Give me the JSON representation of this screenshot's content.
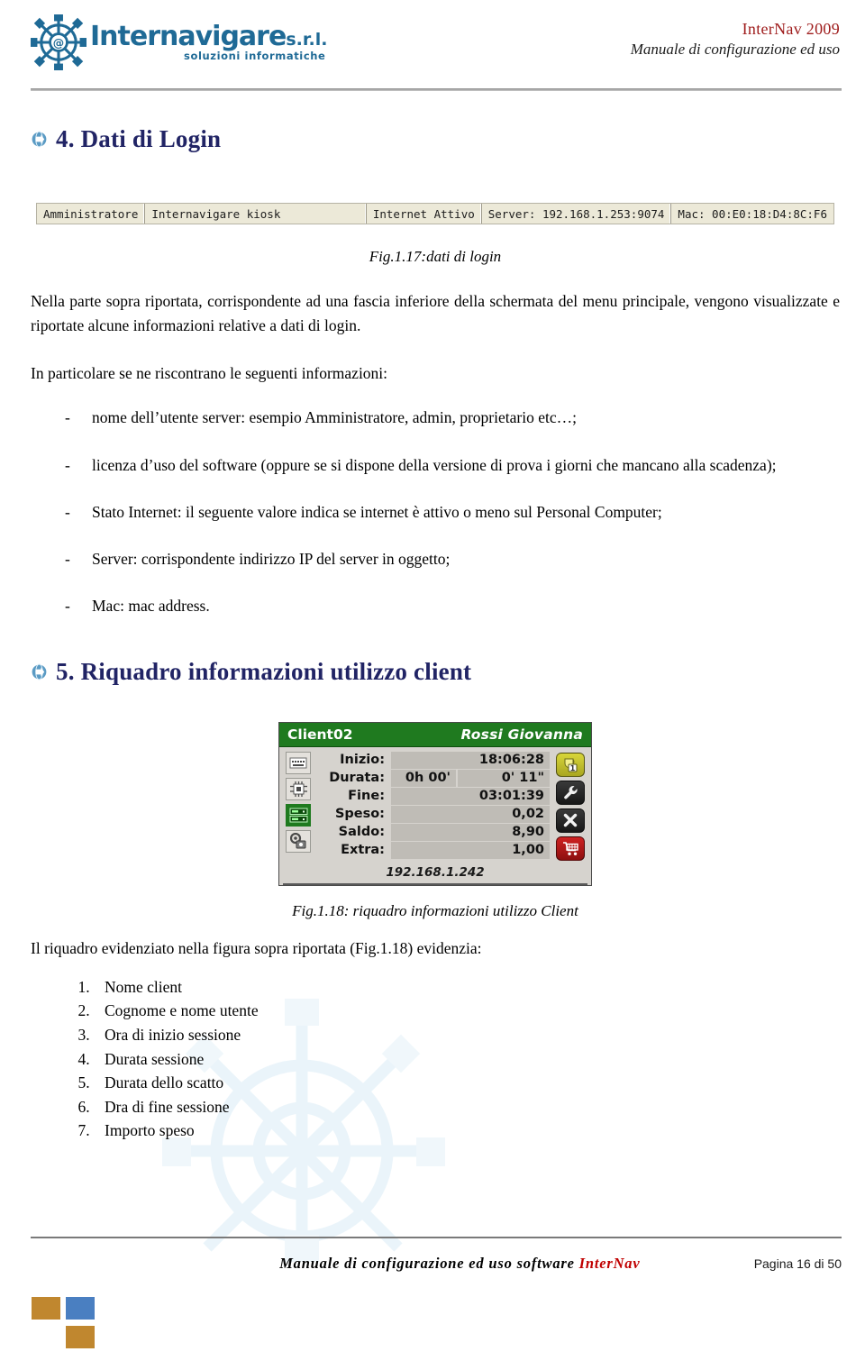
{
  "header": {
    "logo_name": "Internavigare",
    "logo_suffix": "s.r.l.",
    "logo_tagline": "soluzioni   informatiche",
    "title": "InterNav 2009",
    "subtitle": "Manuale di configurazione ed uso"
  },
  "sections": {
    "login": {
      "heading": "4. Dati di Login",
      "figure_caption": "Fig.1.17:dati di login",
      "intro": "Nella parte sopra riportata, corrispondente ad una fascia inferiore della schermata del menu principale, vengono visualizzate e riportate alcune informazioni relative a dati di login.",
      "lead": "In particolare se ne riscontrano le seguenti informazioni:",
      "bullets": [
        "nome dell’utente server: esempio Amministratore, admin, proprietario etc…;",
        "licenza d’uso del software (oppure se si dispone della versione di prova i giorni che mancano alla scadenza);",
        "Stato Internet: il seguente valore indica se internet è attivo o meno sul Personal Computer;",
        "Server: corrispondente indirizzo IP del server in oggetto;",
        "Mac: mac address."
      ],
      "dash": "-"
    },
    "client": {
      "heading": "5. Riquadro informazioni utilizzo client",
      "figure_caption": "Fig.1.18: riquadro informazioni utilizzo Client",
      "intro": "Il riquadro evidenziato nella figura sopra riportata (Fig.1.18) evidenzia:",
      "items": [
        "Nome client",
        "Cognome e nome utente",
        "Ora di inizio sessione",
        "Durata sessione",
        "Durata dello scatto",
        "Dra di fine sessione",
        "Importo speso"
      ]
    }
  },
  "statusbar": {
    "user": "Amministratore",
    "license": "Internavigare kiosk",
    "internet": "Internet Attivo",
    "server": "Server: 192.168.1.253:9074",
    "mac": "Mac: 00:E0:18:D4:8C:F6"
  },
  "client_panel": {
    "client_name": "Client02",
    "user_name": "Rossi Giovanna",
    "rows": [
      {
        "label": "Inizio:",
        "value": "18:06:28"
      },
      {
        "label": "Durata:",
        "value_a": "0h 00'",
        "value_b": "0' 11\""
      },
      {
        "label": "Fine:",
        "value": "03:01:39"
      },
      {
        "label": "Speso:",
        "value": "0,02"
      },
      {
        "label": "Saldo:",
        "value": "8,90"
      },
      {
        "label": "Extra:",
        "value": "1,00"
      }
    ],
    "ip": "192.168.1.242",
    "left_icons": [
      "keyboard-icon",
      "chip-icon",
      "server-icon",
      "lock-icon"
    ],
    "right_buttons": [
      "coin-timer-icon",
      "wrench-icon",
      "close-x-icon",
      "cart-icon"
    ]
  },
  "footer": {
    "text_plain": "Manuale di configurazione ed uso software ",
    "text_brand": "InterNav",
    "page": "Pagina 16 di 50"
  },
  "colors": {
    "accent_blue": "#1f6a96",
    "heading_navy": "#212465",
    "title_red": "#9e1b1b",
    "brand_red": "#c00000",
    "panel_green": "#1f7a1f",
    "square_orange": "#c0872f",
    "square_blue": "#4a7fc1"
  }
}
